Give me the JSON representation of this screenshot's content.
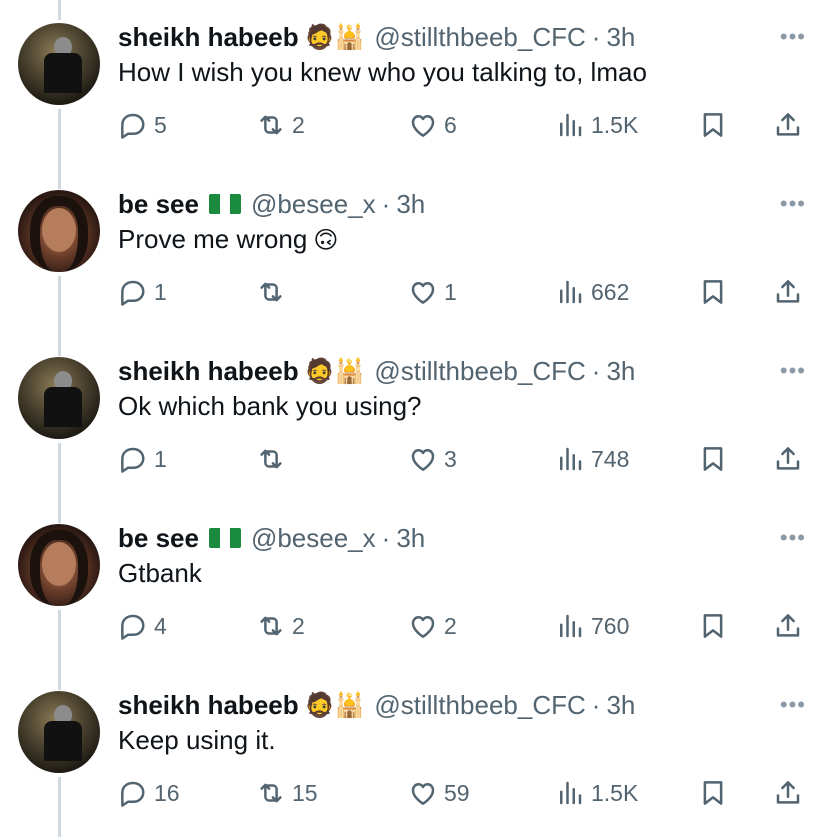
{
  "tweets": [
    {
      "name": "sheikh habeeb",
      "emoji": "🧔🕌",
      "handle": "@stillthbeeb_CFC",
      "time": "3h",
      "text": "How I wish you knew who you talking to, lmao",
      "text_emoji": "",
      "replies": "5",
      "retweets": "2",
      "likes": "6",
      "views": "1.5K",
      "avatar": "sheikh",
      "flag": ""
    },
    {
      "name": "be see",
      "emoji": "",
      "handle": "@besee_x",
      "time": "3h",
      "text": "Prove me wrong",
      "text_emoji": "🙃",
      "replies": "1",
      "retweets": "",
      "likes": "1",
      "views": "662",
      "avatar": "besee",
      "flag": "nigeria-flag"
    },
    {
      "name": "sheikh habeeb",
      "emoji": "🧔🕌",
      "handle": "@stillthbeeb_CFC",
      "time": "3h",
      "text": "Ok which bank you using?",
      "text_emoji": "",
      "replies": "1",
      "retweets": "",
      "likes": "3",
      "views": "748",
      "avatar": "sheikh",
      "flag": ""
    },
    {
      "name": "be see",
      "emoji": "",
      "handle": "@besee_x",
      "time": "3h",
      "text": "Gtbank",
      "text_emoji": "",
      "replies": "4",
      "retweets": "2",
      "likes": "2",
      "views": "760",
      "avatar": "besee",
      "flag": "nigeria-flag"
    },
    {
      "name": "sheikh habeeb",
      "emoji": "🧔🕌",
      "handle": "@stillthbeeb_CFC",
      "time": "3h",
      "text": "Keep using it.",
      "text_emoji": "",
      "replies": "16",
      "retweets": "15",
      "likes": "59",
      "views": "1.5K",
      "avatar": "sheikh",
      "flag": ""
    }
  ],
  "ui": {
    "separator": "·",
    "more": "•••"
  },
  "colors": {
    "text": "#0f1419",
    "secondary": "#536471",
    "thread_line": "#cfd9de",
    "nigeria_green": "#1a8a3e"
  }
}
